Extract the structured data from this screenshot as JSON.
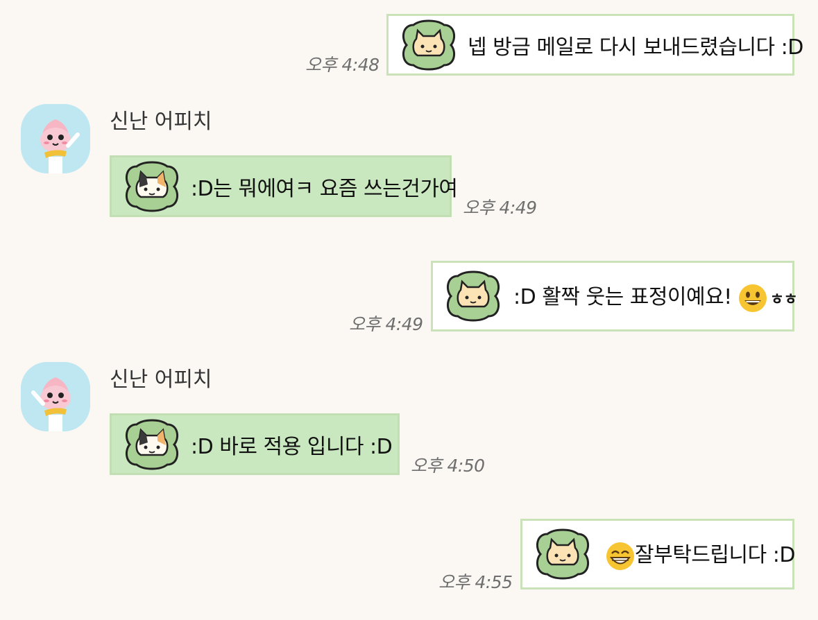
{
  "colors": {
    "background": "#fbf8f4",
    "my_bubble": "#ffffff",
    "their_bubble": "#c9e8c0",
    "bubble_border": "#c9e2b8",
    "time_text": "#6e6e6e"
  },
  "messages": [
    {
      "side": "mine",
      "sticker": "cream-cat-icon",
      "text": "넵 방금 메일로 다시 보내드렸습니다 :D",
      "time": "오후 4:48"
    },
    {
      "side": "theirs",
      "sender": "신난 어피치",
      "sticker": "calico-cat-icon",
      "text": ":D는 뭐에여ㅋ 요즘 쓰는건가여",
      "time": "오후 4:49"
    },
    {
      "side": "mine",
      "sticker": "cream-cat-icon",
      "text": ":D 활짝 웃는 표정이예요!",
      "emoji": "grinning-face-emoji",
      "suffix": "ㅎㅎ",
      "time": "오후 4:49"
    },
    {
      "side": "theirs",
      "sender": "신난 어피치",
      "sticker": "calico-cat-icon",
      "text": ":D 바로 적용 입니다 :D",
      "time": "오후 4:50"
    },
    {
      "side": "mine",
      "sticker": "cream-cat-icon",
      "emoji": "beaming-face-emoji",
      "text": "잘부탁드립니다 :D",
      "time": "오후 4:55"
    }
  ]
}
